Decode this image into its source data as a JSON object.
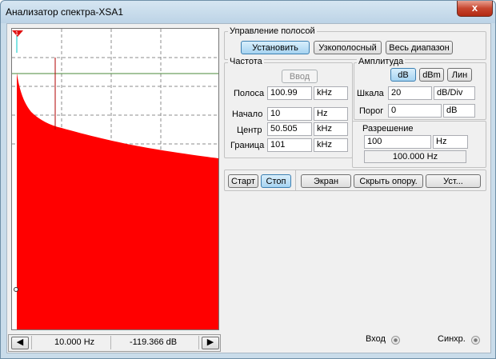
{
  "window": {
    "title": "Анализатор спектра-XSA1",
    "close_symbol": "x"
  },
  "display": {
    "marker_label": "1",
    "background_color": "#ffffff",
    "spectrum_color": "#ff0000",
    "reference_line_color": "#4a8a3a",
    "cursor_color": "#00c8c8"
  },
  "statusbar": {
    "left_arrow": "◀",
    "right_arrow": "▶",
    "frequency": "10.000  Hz",
    "level": "-119.366  dB"
  },
  "band_control": {
    "legend": "Управление полосой",
    "set_label": "Установить",
    "narrow_label": "Узкополосный",
    "full_label": "Весь диапазон"
  },
  "frequency": {
    "legend": "Частота",
    "enter_label": "Ввод",
    "rows": [
      {
        "label": "Полоса",
        "value": "100.99",
        "unit": "kHz"
      },
      {
        "label": "Начало",
        "value": "10",
        "unit": "Hz"
      },
      {
        "label": "Центр",
        "value": "50.505",
        "unit": "kHz"
      },
      {
        "label": "Граница",
        "value": "101",
        "unit": "kHz"
      }
    ]
  },
  "amplitude": {
    "legend": "Амплитуда",
    "db_label": "dB",
    "dbm_label": "dBm",
    "lin_label": "Лин",
    "scale_label": "Шкала",
    "scale_value": "20",
    "scale_unit": "dB/Div",
    "threshold_label": "Порог",
    "threshold_value": "0",
    "threshold_unit": "dB"
  },
  "resolution": {
    "legend": "Разрешение",
    "value": "100",
    "unit": "Hz",
    "readout": "100.000  Hz"
  },
  "controls": {
    "start_label": "Старт",
    "stop_label": "Стоп",
    "screen_label": "Экран",
    "hide_ref_label": "Скрыть опору.",
    "settings_label": "Уст..."
  },
  "terminals": {
    "input_label": "Вход",
    "sync_label": "Синхр."
  }
}
